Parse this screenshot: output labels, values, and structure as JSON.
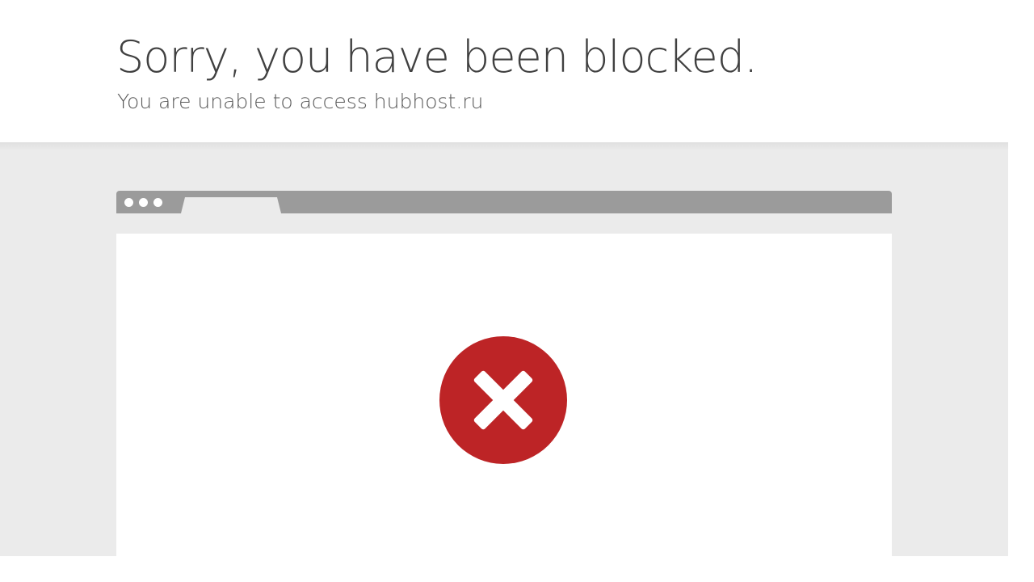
{
  "header": {
    "title": "Sorry, you have been blocked.",
    "subtitle": "You are unable to access hubhost.ru"
  },
  "illustration": {
    "browser_window_icon": "browser-window-icon",
    "status_icon": "error-x-icon"
  },
  "colors": {
    "error_red": "#bd2426",
    "browser_bar": "#9b9b9b",
    "stage_background": "#ebebeb",
    "title_text": "#404040",
    "subtitle_text": "#595959"
  }
}
